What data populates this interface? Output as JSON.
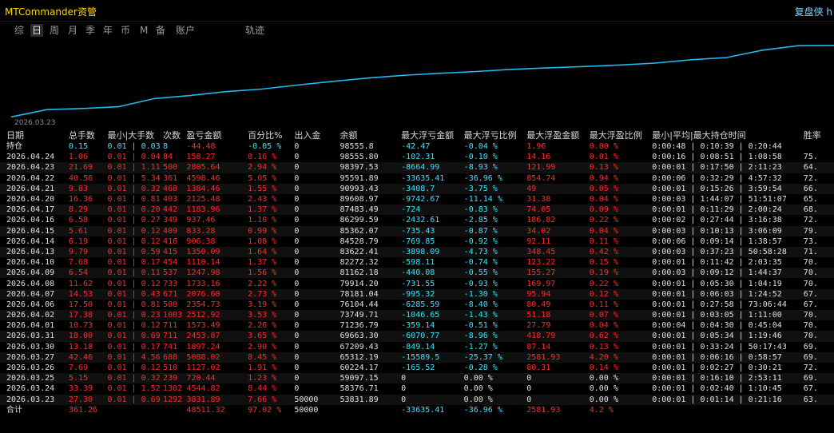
{
  "app": {
    "title": "MTCommander资管",
    "right_title": "复盘侠 h"
  },
  "tabs": [
    {
      "label": "综",
      "active": false
    },
    {
      "label": "日",
      "active": true
    },
    {
      "label": "周",
      "active": false
    },
    {
      "label": "月",
      "active": false
    },
    {
      "label": "季",
      "active": false
    },
    {
      "label": "年",
      "active": false
    },
    {
      "label": "币",
      "active": false
    },
    {
      "label": "M",
      "active": false
    },
    {
      "label": "备",
      "active": false
    },
    {
      "label": "账户",
      "active": false
    },
    {
      "label": "轨迹",
      "active": false
    }
  ],
  "chart_data": {
    "type": "line",
    "x_start_label": "2026.03.23",
    "x": [
      "2026.03.23",
      "2026.03.24",
      "2026.03.25",
      "2026.03.26",
      "2026.03.27",
      "2026.03.30",
      "2026.03.31",
      "2026.04.01",
      "2026.04.02",
      "2026.04.06",
      "2026.04.07",
      "2026.04.08",
      "2026.04.09",
      "2026.04.10",
      "2026.04.13",
      "2026.04.14",
      "2026.04.15",
      "2026.04.16",
      "2026.04.17",
      "2026.04.20",
      "2026.04.21",
      "2026.04.22",
      "2026.04.23",
      "2026.04.24"
    ],
    "values": [
      53831.89,
      58376.71,
      59097.15,
      60224.17,
      65312.19,
      67209.43,
      69663.3,
      71236.79,
      73749.71,
      76104.44,
      78181.04,
      79914.2,
      81162.18,
      82272.32,
      83622.41,
      84528.79,
      85362.07,
      86299.59,
      87483.49,
      89608.97,
      90993.43,
      95591.89,
      98397.53,
      98555.8
    ],
    "ylim": [
      53000,
      100000
    ],
    "color": "#22b8f0"
  },
  "table": {
    "headers": [
      "日期",
      "总手数",
      "最小|大手数",
      "次数",
      "盈亏金额",
      "百分比%",
      "出入金",
      "余额",
      "最大浮亏金额",
      "最大浮亏比例",
      "最大浮盈金额",
      "最大浮盈比例",
      "最小|平均|最大持仓时间",
      "胜率"
    ],
    "holding": {
      "date": "持仓",
      "total": "0.15",
      "minmax": "0.01 | 0.03",
      "count": "8",
      "pnl": "-44.48",
      "pct": "-0.05 %",
      "io": "0",
      "balance": "98555.8",
      "mfl": "-42.47",
      "mflp": "-0.04 %",
      "mfp": "1.96",
      "mfpp": "0.00 %",
      "time": "0:00:48 | 0:10:39 | 0:20:44",
      "win": ""
    },
    "rows": [
      {
        "date": "2026.04.24",
        "total": "1.06",
        "minmax": "0.01 | 0.04",
        "count": "84",
        "pnl": "158.27",
        "pct": "0.16 %",
        "io": "0",
        "balance": "98555.80",
        "mfl": "-102.31",
        "mflp": "-0.10 %",
        "mfp": "14.16",
        "mfpp": "0.01 %",
        "time": "0:00:16 | 0:08:51 | 1:08:58",
        "win": "75."
      },
      {
        "date": "2026.04.23",
        "total": "21.69",
        "minmax": "0.01 | 1.11",
        "count": "500",
        "pnl": "2805.64",
        "pct": "2.94 %",
        "io": "0",
        "balance": "98397.53",
        "mfl": "-8664.99",
        "mflp": "-8.93 %",
        "mfp": "121.99",
        "mfpp": "0.13 %",
        "time": "0:00:01 | 0:17:50 | 2:11:23",
        "win": "64."
      },
      {
        "date": "2026.04.22",
        "total": "40.56",
        "minmax": "0.01 | 5.34",
        "count": "361",
        "pnl": "4598.46",
        "pct": "5.05 %",
        "io": "0",
        "balance": "95591.89",
        "mfl": "-33635.41",
        "mflp": "-36.96 %",
        "mfp": "854.74",
        "mfpp": "0.94 %",
        "time": "0:00:06 | 0:32:29 | 4:57:32",
        "win": "72."
      },
      {
        "date": "2026.04.21",
        "total": "9.83",
        "minmax": "0.01 | 0.32",
        "count": "468",
        "pnl": "1384.46",
        "pct": "1.55 %",
        "io": "0",
        "balance": "90993.43",
        "mfl": "-3408.7",
        "mflp": "-3.75 %",
        "mfp": "49",
        "mfpp": "0.05 %",
        "time": "0:00:01 | 0:15:26 | 3:59:54",
        "win": "66."
      },
      {
        "date": "2026.04.20",
        "total": "16.36",
        "minmax": "0.01 | 0.81",
        "count": "403",
        "pnl": "2125.48",
        "pct": "2.43 %",
        "io": "0",
        "balance": "89608.97",
        "mfl": "-9742.67",
        "mflp": "-11.14 %",
        "mfp": "31.38",
        "mfpp": "0.04 %",
        "time": "0:00:03 | 1:44:07 | 51:51:07",
        "win": "65."
      },
      {
        "date": "2026.04.17",
        "total": "8.29",
        "minmax": "0.01 | 0.20",
        "count": "442",
        "pnl": "1183.96",
        "pct": "1.37 %",
        "io": "0",
        "balance": "87483.49",
        "mfl": "-724",
        "mflp": "-0.83 %",
        "mfp": "74.05",
        "mfpp": "0.09 %",
        "time": "0:00:01 | 0:11:29 | 2:00:24",
        "win": "68."
      },
      {
        "date": "2026.04.16",
        "total": "6.58",
        "minmax": "0.01 | 0.27",
        "count": "349",
        "pnl": "937.46",
        "pct": "1.10 %",
        "io": "0",
        "balance": "86299.59",
        "mfl": "-2432.61",
        "mflp": "-2.85 %",
        "mfp": "186.82",
        "mfpp": "0.22 %",
        "time": "0:00:02 | 0:27:44 | 3:16:38",
        "win": "72."
      },
      {
        "date": "2026.04.15",
        "total": "5.61",
        "minmax": "0.01 | 0.12",
        "count": "409",
        "pnl": "833.28",
        "pct": "0.99 %",
        "io": "0",
        "balance": "85362.07",
        "mfl": "-735.43",
        "mflp": "-0.87 %",
        "mfp": "34.02",
        "mfpp": "0.04 %",
        "time": "0:00:03 | 0:10:13 | 3:06:09",
        "win": "79."
      },
      {
        "date": "2026.04.14",
        "total": "6.19",
        "minmax": "0.01 | 0.12",
        "count": "416",
        "pnl": "906.38",
        "pct": "1.08 %",
        "io": "0",
        "balance": "84528.79",
        "mfl": "-769.85",
        "mflp": "-0.92 %",
        "mfp": "92.11",
        "mfpp": "0.11 %",
        "time": "0:00:06 | 0:09:14 | 1:38:57",
        "win": "73."
      },
      {
        "date": "2026.04.13",
        "total": "9.79",
        "minmax": "0.01 | 0.59",
        "count": "415",
        "pnl": "1350.09",
        "pct": "1.64 %",
        "io": "0",
        "balance": "83622.41",
        "mfl": "-3898.09",
        "mflp": "-4.73 %",
        "mfp": "348.45",
        "mfpp": "0.42 %",
        "time": "0:00:03 | 0:37:23 | 50:58:28",
        "win": "71."
      },
      {
        "date": "2026.04.10",
        "total": "7.68",
        "minmax": "0.01 | 0.17",
        "count": "454",
        "pnl": "1110.14",
        "pct": "1.37 %",
        "io": "0",
        "balance": "82272.32",
        "mfl": "-598.11",
        "mflp": "-0.74 %",
        "mfp": "123.22",
        "mfpp": "0.15 %",
        "time": "0:00:01 | 0:11:42 | 2:03:35",
        "win": "70."
      },
      {
        "date": "2026.04.09",
        "total": "6.54",
        "minmax": "0.01 | 0.11",
        "count": "537",
        "pnl": "1247.98",
        "pct": "1.56 %",
        "io": "0",
        "balance": "81162.18",
        "mfl": "-440.08",
        "mflp": "-0.55 %",
        "mfp": "155.27",
        "mfpp": "0.19 %",
        "time": "0:00:03 | 0:09:12 | 1:44:37",
        "win": "70."
      },
      {
        "date": "2026.04.08",
        "total": "11.62",
        "minmax": "0.01 | 0.12",
        "count": "733",
        "pnl": "1733.16",
        "pct": "2.22 %",
        "io": "0",
        "balance": "79914.20",
        "mfl": "-731.55",
        "mflp": "-0.93 %",
        "mfp": "169.97",
        "mfpp": "0.22 %",
        "time": "0:00:01 | 0:05:30 | 1:04:19",
        "win": "70."
      },
      {
        "date": "2026.04.07",
        "total": "14.53",
        "minmax": "0.01 | 0.43",
        "count": "671",
        "pnl": "2076.60",
        "pct": "2.73 %",
        "io": "0",
        "balance": "78181.04",
        "mfl": "-995.32",
        "mflp": "-1.30 %",
        "mfp": "95.94",
        "mfpp": "0.12 %",
        "time": "0:00:01 | 0:06:03 | 1:24:52",
        "win": "67."
      },
      {
        "date": "2026.04.06",
        "total": "17.50",
        "minmax": "0.01 | 0.81",
        "count": "588",
        "pnl": "2354.73",
        "pct": "3.19 %",
        "io": "0",
        "balance": "76104.44",
        "mfl": "-6285.59",
        "mflp": "-8.40 %",
        "mfp": "80.49",
        "mfpp": "0.11 %",
        "time": "0:00:01 | 0:27:58 | 73:06:44",
        "win": "67."
      },
      {
        "date": "2026.04.02",
        "total": "17.38",
        "minmax": "0.01 | 0.23",
        "count": "1003",
        "pnl": "2512.92",
        "pct": "3.53 %",
        "io": "0",
        "balance": "73749.71",
        "mfl": "-1046.65",
        "mflp": "-1.43 %",
        "mfp": "51.18",
        "mfpp": "0.07 %",
        "time": "0:00:01 | 0:03:05 | 1:11:00",
        "win": "70."
      },
      {
        "date": "2026.04.01",
        "total": "10.73",
        "minmax": "0.01 | 0.12",
        "count": "711",
        "pnl": "1573.49",
        "pct": "2.26 %",
        "io": "0",
        "balance": "71236.79",
        "mfl": "-359.14",
        "mflp": "-0.51 %",
        "mfp": "27.79",
        "mfpp": "0.04 %",
        "time": "0:00:04 | 0:04:30 | 0:45:04",
        "win": "70."
      },
      {
        "date": "2026.03.31",
        "total": "18.00",
        "minmax": "0.01 | 0.69",
        "count": "711",
        "pnl": "2453.87",
        "pct": "3.65 %",
        "io": "0",
        "balance": "69663.30",
        "mfl": "-6070.77",
        "mflp": "-8.96 %",
        "mfp": "418.79",
        "mfpp": "0.62 %",
        "time": "0:00:01 | 0:05:34 | 1:19:46",
        "win": "70."
      },
      {
        "date": "2026.03.30",
        "total": "13.18",
        "minmax": "0.01 | 0.17",
        "count": "741",
        "pnl": "1897.24",
        "pct": "2.90 %",
        "io": "0",
        "balance": "67209.43",
        "mfl": "-849.14",
        "mflp": "-1.27 %",
        "mfp": "87.14",
        "mfpp": "0.13 %",
        "time": "0:00:01 | 0:33:24 | 50:17:43",
        "win": "69."
      },
      {
        "date": "2026.03.27",
        "total": "42.46",
        "minmax": "0.01 | 4.56",
        "count": "688",
        "pnl": "5088.02",
        "pct": "8.45 %",
        "io": "0",
        "balance": "65312.19",
        "mfl": "-15589.5",
        "mflp": "-25.37 %",
        "mfp": "2581.93",
        "mfpp": "4.20 %",
        "time": "0:00:01 | 0:06:16 | 0:58:57",
        "win": "69."
      },
      {
        "date": "2026.03.26",
        "total": "7.69",
        "minmax": "0.01 | 0.12",
        "count": "510",
        "pnl": "1127.02",
        "pct": "1.91 %",
        "io": "0",
        "balance": "60224.17",
        "mfl": "-165.52",
        "mflp": "-0.28 %",
        "mfp": "80.31",
        "mfpp": "0.14 %",
        "time": "0:00:01 | 0:02:27 | 0:30:21",
        "win": "72."
      },
      {
        "date": "2026.03.25",
        "total": "5.15",
        "minmax": "0.01 | 0.32",
        "count": "239",
        "pnl": "720.44",
        "pct": "1.23 %",
        "io": "0",
        "balance": "59097.15",
        "mfl": "0",
        "mflp": "0.00 %",
        "mfp": "0",
        "mfpp": "0.00 %",
        "time": "0:00:01 | 0:16:10 | 2:53:11",
        "win": "69."
      },
      {
        "date": "2026.03.24",
        "total": "33.39",
        "minmax": "0.01 | 1.52",
        "count": "1302",
        "pnl": "4544.82",
        "pct": "8.44 %",
        "io": "0",
        "balance": "58376.71",
        "mfl": "0",
        "mflp": "0.00 %",
        "mfp": "0",
        "mfpp": "0.00 %",
        "time": "0:00:01 | 0:02:40 | 1:10:45",
        "win": "67."
      },
      {
        "date": "2026.03.23",
        "total": "27.30",
        "minmax": "0.01 | 0.69",
        "count": "1292",
        "pnl": "3831.89",
        "pct": "7.66 %",
        "io": "50000",
        "balance": "53831.89",
        "mfl": "0",
        "mflp": "0.00 %",
        "mfp": "0",
        "mfpp": "0.00 %",
        "time": "0:00:01 | 0:01:14 | 0:21:16",
        "win": "63."
      }
    ],
    "summary": {
      "date": "合计",
      "total": "361.26",
      "minmax": "",
      "count": "",
      "pnl": "48511.32",
      "pct": "97.02 %",
      "io": "50000",
      "balance": "",
      "mfl": "-33635.41",
      "mflp": "-36.96 %",
      "mfp": "2581.93",
      "mfpp": "4.2 %",
      "time": "",
      "win": ""
    }
  }
}
